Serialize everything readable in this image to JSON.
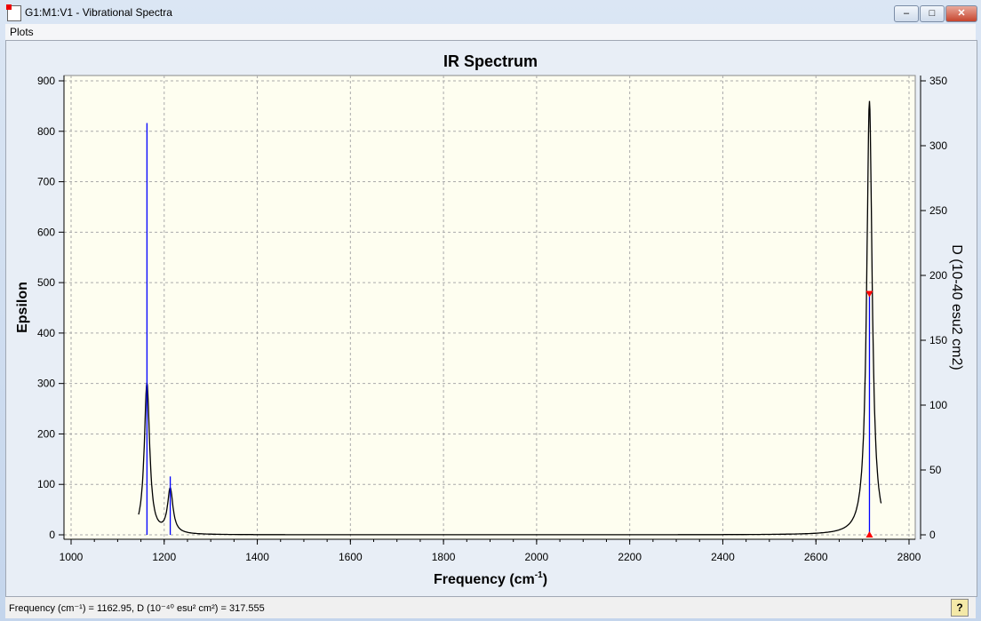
{
  "window": {
    "title": "G1:M1:V1 - Vibrational Spectra",
    "minimize": "–",
    "maximize": "□",
    "close": "✕"
  },
  "menu": {
    "plots": "Plots"
  },
  "status": {
    "text": "Frequency (cm⁻¹) = 1162.95, D (10⁻⁴⁰ esu² cm²) = 317.555",
    "help": "?"
  },
  "chart_data": {
    "type": "line",
    "title": "IR Spectrum",
    "xlabel": "Frequency (cm",
    "xlabel_sup": "-1",
    "xlabel_end": ")",
    "ylabel": "Epsilon",
    "y2label": "D (10-40 esu2 cm2)",
    "xlim": [
      1000,
      2800
    ],
    "ylim": [
      0,
      900
    ],
    "y2lim": [
      0,
      350
    ],
    "xticks": [
      1000,
      1200,
      1400,
      1600,
      1800,
      2000,
      2200,
      2400,
      2600,
      2800
    ],
    "yticks": [
      0,
      100,
      200,
      300,
      400,
      500,
      600,
      700,
      800,
      900
    ],
    "y2ticks": [
      0,
      50,
      100,
      150,
      200,
      250,
      300,
      350
    ],
    "grid": true,
    "sticks": [
      {
        "x": 1163,
        "D": 317.5
      },
      {
        "x": 1213,
        "D": 45
      },
      {
        "x": 2715,
        "D": 186
      }
    ],
    "curve_peaks": [
      {
        "x": 1163,
        "epsilon": 300
      },
      {
        "x": 1213,
        "epsilon": 88
      },
      {
        "x": 2715,
        "epsilon": 860
      }
    ],
    "curve_range": [
      1145,
      2740
    ],
    "selected": {
      "x": 2715,
      "D": 186
    },
    "colors": {
      "curve": "#000000",
      "sticks": "#0000ff",
      "marker": "#ff0000",
      "plot_bg": "#fefef0"
    }
  }
}
